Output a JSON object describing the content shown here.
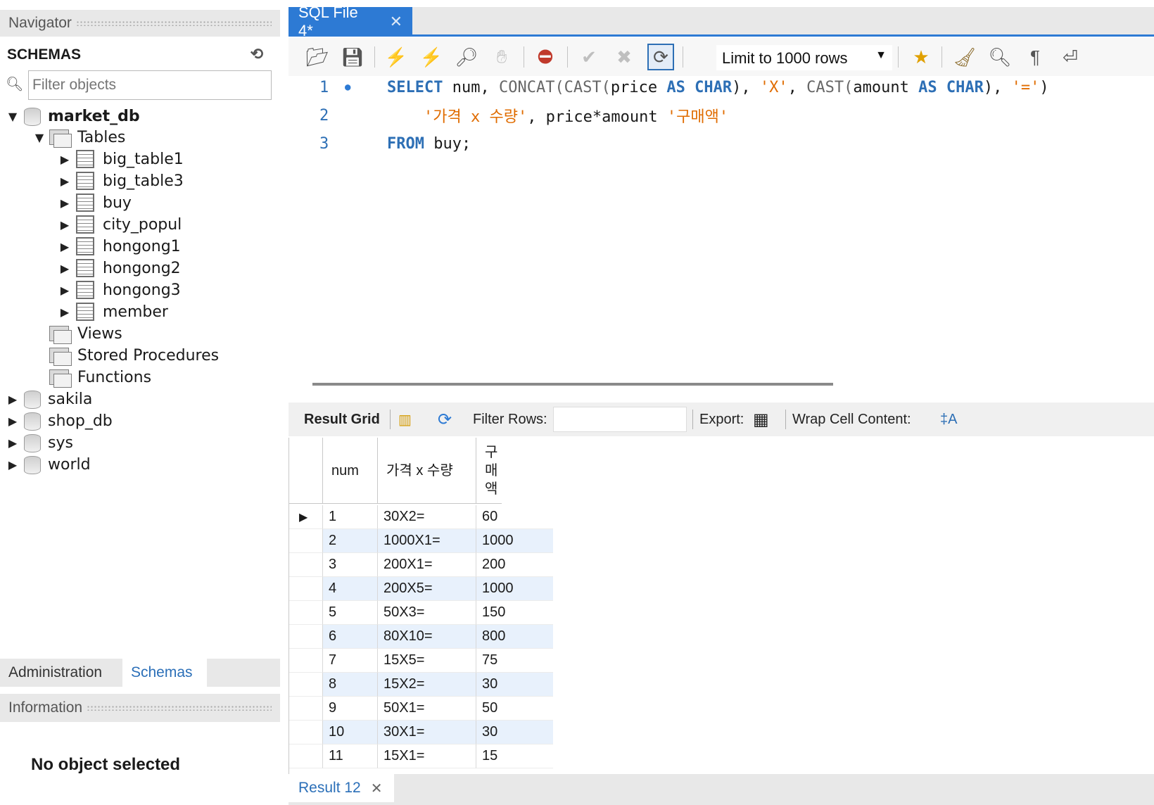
{
  "navigator": {
    "title": "Navigator",
    "schemas_label": "SCHEMAS",
    "filter_placeholder": "Filter objects",
    "tree": [
      {
        "label": "market_db",
        "expanded": true
      },
      {
        "label": "Tables",
        "expanded": true
      },
      {
        "label": "big_table1"
      },
      {
        "label": "big_table3"
      },
      {
        "label": "buy"
      },
      {
        "label": "city_popul"
      },
      {
        "label": "hongong1"
      },
      {
        "label": "hongong2"
      },
      {
        "label": "hongong3"
      },
      {
        "label": "member"
      },
      {
        "label": "Views"
      },
      {
        "label": "Stored Procedures"
      },
      {
        "label": "Functions"
      },
      {
        "label": "sakila"
      },
      {
        "label": "shop_db"
      },
      {
        "label": "sys"
      },
      {
        "label": "world"
      }
    ],
    "tabs": [
      "Administration",
      "Schemas"
    ],
    "active_tab": "Schemas",
    "info_title": "Information",
    "info_message": "No object selected"
  },
  "editor": {
    "tab_title": "SQL File 4*",
    "limit_label": "Limit to 1000 rows",
    "lines": [
      {
        "num": "1"
      },
      {
        "num": "2"
      },
      {
        "num": "3"
      }
    ],
    "code": {
      "l1_select": "SELECT",
      "l1_rest1": " num, ",
      "l1_concat": "CONCAT(CAST(",
      "l1_price": "price ",
      "l1_as1": "AS",
      "l1_char1": " CHAR",
      "l1_p1": "), ",
      "l1_x": "'X'",
      "l1_comma": ", ",
      "l1_cast": "CAST(",
      "l1_amount": "amount ",
      "l1_as2": "AS",
      "l1_char2": " CHAR",
      "l1_p2": "), ",
      "l1_eq": "'='",
      "l1_end": ")",
      "l2_str1": "'가격 x 수량'",
      "l2_mid": ", price*amount ",
      "l2_str2": "'구매액'",
      "l3_from": "FROM",
      "l3_rest": " buy;"
    }
  },
  "results": {
    "grid_label": "Result Grid",
    "filter_label": "Filter Rows:",
    "export_label": "Export:",
    "wrap_label": "Wrap Cell Content:",
    "columns": [
      "num",
      "가격 x 수량",
      "구매액"
    ],
    "rows": [
      [
        "1",
        "30X2=",
        "60"
      ],
      [
        "2",
        "1000X1=",
        "1000"
      ],
      [
        "3",
        "200X1=",
        "200"
      ],
      [
        "4",
        "200X5=",
        "1000"
      ],
      [
        "5",
        "50X3=",
        "150"
      ],
      [
        "6",
        "80X10=",
        "800"
      ],
      [
        "7",
        "15X5=",
        "75"
      ],
      [
        "8",
        "15X2=",
        "30"
      ],
      [
        "9",
        "50X1=",
        "50"
      ],
      [
        "10",
        "30X1=",
        "30"
      ],
      [
        "11",
        "15X1=",
        "15"
      ]
    ],
    "result_tab": "Result 12"
  }
}
